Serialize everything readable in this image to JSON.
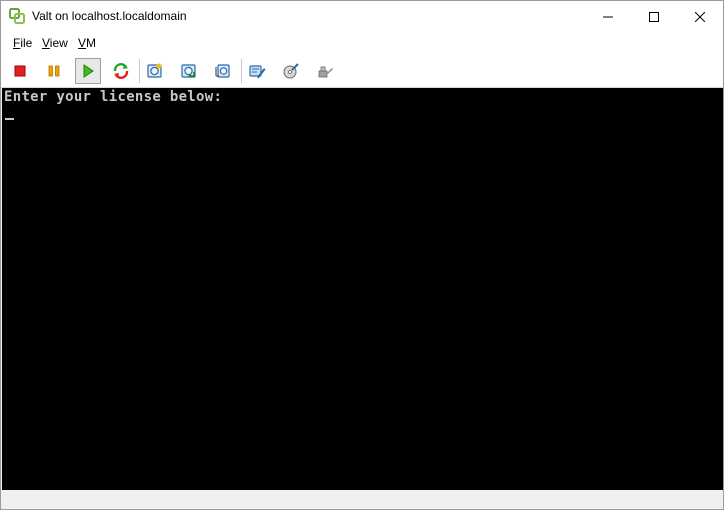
{
  "window": {
    "title": "Valt on localhost.localdomain",
    "icon": "vsphere-icon"
  },
  "menu": {
    "items": [
      {
        "accel": "F",
        "rest": "ile"
      },
      {
        "accel": "V",
        "rest": "iew"
      },
      {
        "accel": "V",
        "rest": "M"
      }
    ]
  },
  "toolbar": {
    "buttons": [
      "power-off-icon",
      "suspend-icon",
      "power-on-icon",
      "reset-icon",
      "snapshot-icon",
      "revert-snapshot-icon",
      "snapshot-manager-icon",
      "edit-settings-icon",
      "cd-dvd-icon",
      "usb-icon"
    ],
    "active": "power-on-icon"
  },
  "console": {
    "text": "Enter your license below:",
    "background": "#000000",
    "foreground": "#c7c7c7"
  }
}
